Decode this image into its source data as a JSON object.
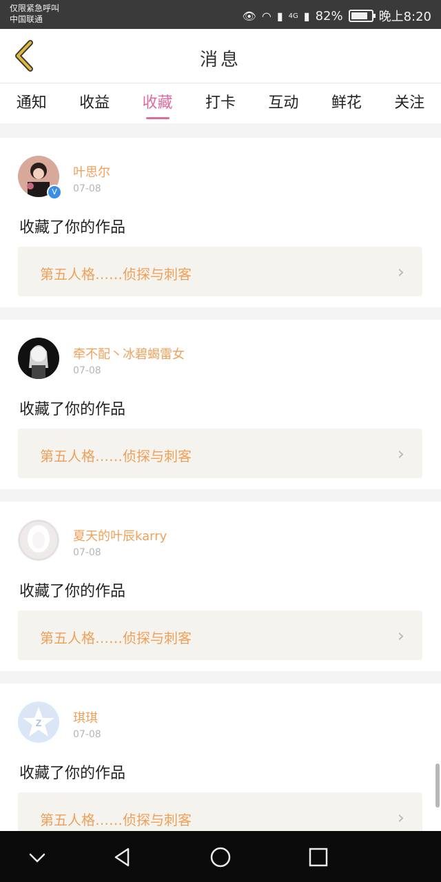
{
  "status_bar": {
    "line1": "仅限紧急呼叫",
    "line2": "中国联通",
    "network": "4G",
    "battery": "82%",
    "time": "晚上8:20"
  },
  "header": {
    "title": "消息"
  },
  "tabs": [
    {
      "label": "通知",
      "active": false
    },
    {
      "label": "收益",
      "active": false
    },
    {
      "label": "收藏",
      "active": true
    },
    {
      "label": "打卡",
      "active": false
    },
    {
      "label": "互动",
      "active": false
    },
    {
      "label": "鲜花",
      "active": false
    },
    {
      "label": "关注",
      "active": false
    }
  ],
  "messages": [
    {
      "user": "叶思尔",
      "date": "07-08",
      "action": "收藏了你的作品",
      "work": "第五人格……侦探与刺客",
      "verified": true
    },
    {
      "user": "牵不配丶冰碧蝎雷女",
      "date": "07-08",
      "action": "收藏了你的作品",
      "work": "第五人格……侦探与刺客",
      "verified": false
    },
    {
      "user": "夏天的叶辰karry",
      "date": "07-08",
      "action": "收藏了你的作品",
      "work": "第五人格……侦探与刺客",
      "verified": false
    },
    {
      "user": "琪琪",
      "date": "07-08",
      "action": "收藏了你的作品",
      "work": "第五人格……侦探与刺客",
      "verified": false
    }
  ],
  "colors": {
    "accent": "#e06aa0",
    "username": "#f0a05a",
    "back_icon": "#e2b83a"
  }
}
